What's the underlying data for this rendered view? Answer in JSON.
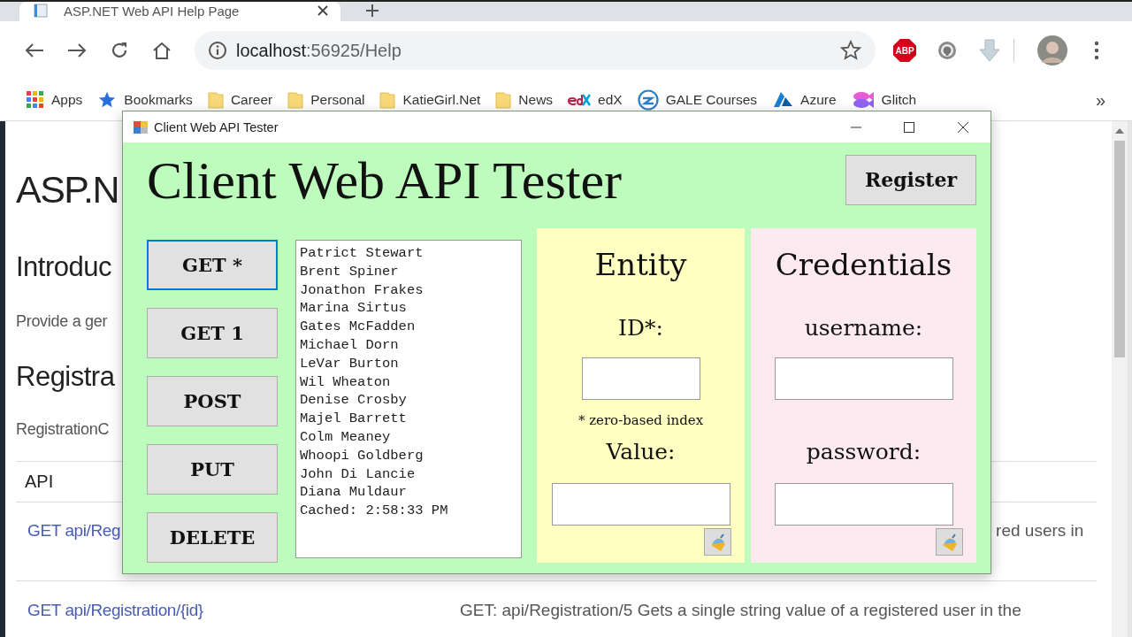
{
  "browser": {
    "tab_title": "ASP.NET Web API Help Page",
    "url_host": "localhost",
    "url_path": ":56925/Help",
    "adblock_label": "ABP",
    "bookmarks_overflow": "»"
  },
  "bookmarks": [
    {
      "kind": "apps",
      "label": "Apps"
    },
    {
      "kind": "star",
      "label": "Bookmarks"
    },
    {
      "kind": "folder",
      "label": "Career"
    },
    {
      "kind": "folder",
      "label": "Personal"
    },
    {
      "kind": "folder",
      "label": "KatieGirl.Net"
    },
    {
      "kind": "folder",
      "label": "News"
    },
    {
      "kind": "edx",
      "label": "edX"
    },
    {
      "kind": "gale",
      "label": "GALE Courses"
    },
    {
      "kind": "azure",
      "label": "Azure"
    },
    {
      "kind": "glitch",
      "label": "Glitch"
    }
  ],
  "page": {
    "heading": "ASP.N",
    "intro_heading": "Introduc",
    "intro_text": "Provide a ger",
    "section_heading": "Registra",
    "section_text": "RegistrationC",
    "table": {
      "header": "API",
      "rows": [
        {
          "api": "GET api/Reg",
          "description": "red users in"
        },
        {
          "api": "GET api/Registration/{id}",
          "description": "GET: api/Registration/5 Gets a single string value of a registered user in the"
        }
      ]
    }
  },
  "dialog": {
    "title": "Client Web API Tester",
    "heading": "Client Web API Tester",
    "register_button": "Register",
    "methods": [
      {
        "label": "GET *",
        "selected": true
      },
      {
        "label": "GET 1",
        "selected": false
      },
      {
        "label": "POST",
        "selected": false
      },
      {
        "label": "PUT",
        "selected": false
      },
      {
        "label": "DELETE",
        "selected": false
      }
    ],
    "results": [
      "Patrict Stewart",
      "Brent Spiner",
      "Jonathon Frakes",
      "Marina Sirtus",
      "Gates McFadden",
      "Michael Dorn",
      "LeVar Burton",
      "Wil Wheaton",
      "Denise Crosby",
      "Majel Barrett",
      "Colm Meaney",
      "Whoopi Goldberg",
      "John Di Lancie",
      "Diana Muldaur",
      "Cached: 2:58:33 PM"
    ],
    "panels": [
      {
        "kind": "entity",
        "title": "Entity",
        "fields": [
          {
            "label": "ID*:",
            "note": "* zero-based index"
          },
          {
            "label": "Value:"
          }
        ]
      },
      {
        "kind": "credentials",
        "title": "Credentials",
        "fields": [
          {
            "label": "username:"
          },
          {
            "label": "password:"
          }
        ]
      }
    ]
  }
}
